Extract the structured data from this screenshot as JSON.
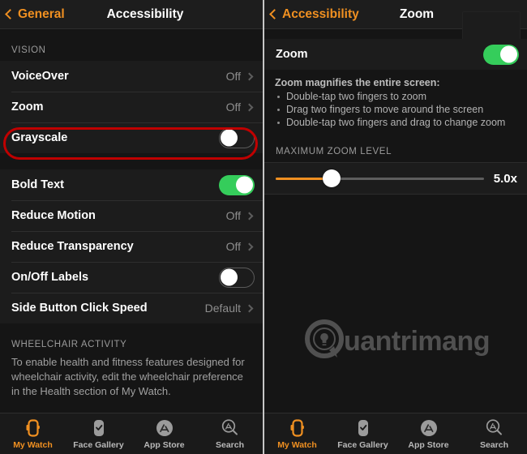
{
  "left_screen": {
    "nav": {
      "back_label": "General",
      "back_icon": "chevron-left-icon",
      "title": "Accessibility"
    },
    "sections": [
      {
        "header": "VISION",
        "rows": [
          {
            "label": "VoiceOver",
            "value": "Off",
            "type": "disclosure"
          },
          {
            "label": "Zoom",
            "value": "Off",
            "type": "disclosure",
            "highlighted": true
          },
          {
            "label": "Grayscale",
            "value": "",
            "type": "toggle",
            "toggle_state": "off"
          }
        ]
      },
      {
        "header": "",
        "rows": [
          {
            "label": "Bold Text",
            "value": "",
            "type": "toggle",
            "toggle_state": "on"
          },
          {
            "label": "Reduce Motion",
            "value": "Off",
            "type": "disclosure"
          },
          {
            "label": "Reduce Transparency",
            "value": "Off",
            "type": "disclosure"
          },
          {
            "label": "On/Off Labels",
            "value": "",
            "type": "toggle",
            "toggle_state": "off"
          },
          {
            "label": "Side Button Click Speed",
            "value": "Default",
            "type": "disclosure"
          }
        ]
      }
    ],
    "footer": {
      "header": "WHEELCHAIR ACTIVITY",
      "text": "To enable health and fitness features designed for wheelchair activity, edit the wheelchair preference in the Health section of My Watch."
    }
  },
  "right_screen": {
    "nav": {
      "back_label": "Accessibility",
      "back_icon": "chevron-left-icon",
      "title": "Zoom"
    },
    "zoom_row": {
      "label": "Zoom",
      "toggle_state": "on"
    },
    "hint": {
      "title": "Zoom magnifies the entire screen:",
      "items": [
        "Double-tap two fingers to zoom",
        "Drag two fingers to move around the screen",
        "Double-tap two fingers and drag to change zoom"
      ]
    },
    "slider_section": {
      "header": "MAXIMUM ZOOM LEVEL",
      "value_label": "5.0x",
      "fill_percent": 27
    },
    "watermark": {
      "text": "uantrimang",
      "logo_icon": "quantrimang-logo-icon"
    }
  },
  "tabbar": {
    "tabs": [
      {
        "label": "My Watch",
        "icon": "watch-outline-icon",
        "active": true
      },
      {
        "label": "Face Gallery",
        "icon": "watch-check-icon",
        "active": false
      },
      {
        "label": "App Store",
        "icon": "app-store-icon",
        "active": false
      },
      {
        "label": "Search",
        "icon": "search-appstore-icon",
        "active": false
      }
    ]
  },
  "colors": {
    "accent_orange": "#f09021",
    "toggle_green": "#35cd5b",
    "highlight_red": "#c00000",
    "background": "#151515",
    "row_background": "#1c1c1c"
  }
}
